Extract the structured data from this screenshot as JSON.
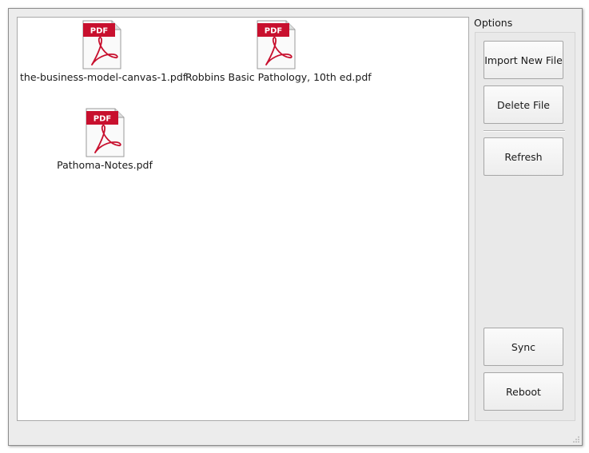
{
  "files": [
    {
      "name": "the-business-model-canvas-1.pdf",
      "icon": "pdf-file-icon",
      "badge": "PDF"
    },
    {
      "name": "Robbins Basic Pathology, 10th ed.pdf",
      "icon": "pdf-file-icon",
      "badge": "PDF"
    },
    {
      "name": "Pathoma-Notes.pdf",
      "icon": "pdf-file-icon",
      "badge": "PDF"
    }
  ],
  "options": {
    "label": "Options",
    "buttons": {
      "import": "Import New File",
      "delete": "Delete File",
      "refresh": "Refresh",
      "sync": "Sync",
      "reboot": "Reboot"
    }
  },
  "colors": {
    "pdf_red": "#c8102e",
    "window_bg": "#ececec",
    "file_area_bg": "#ffffff"
  }
}
